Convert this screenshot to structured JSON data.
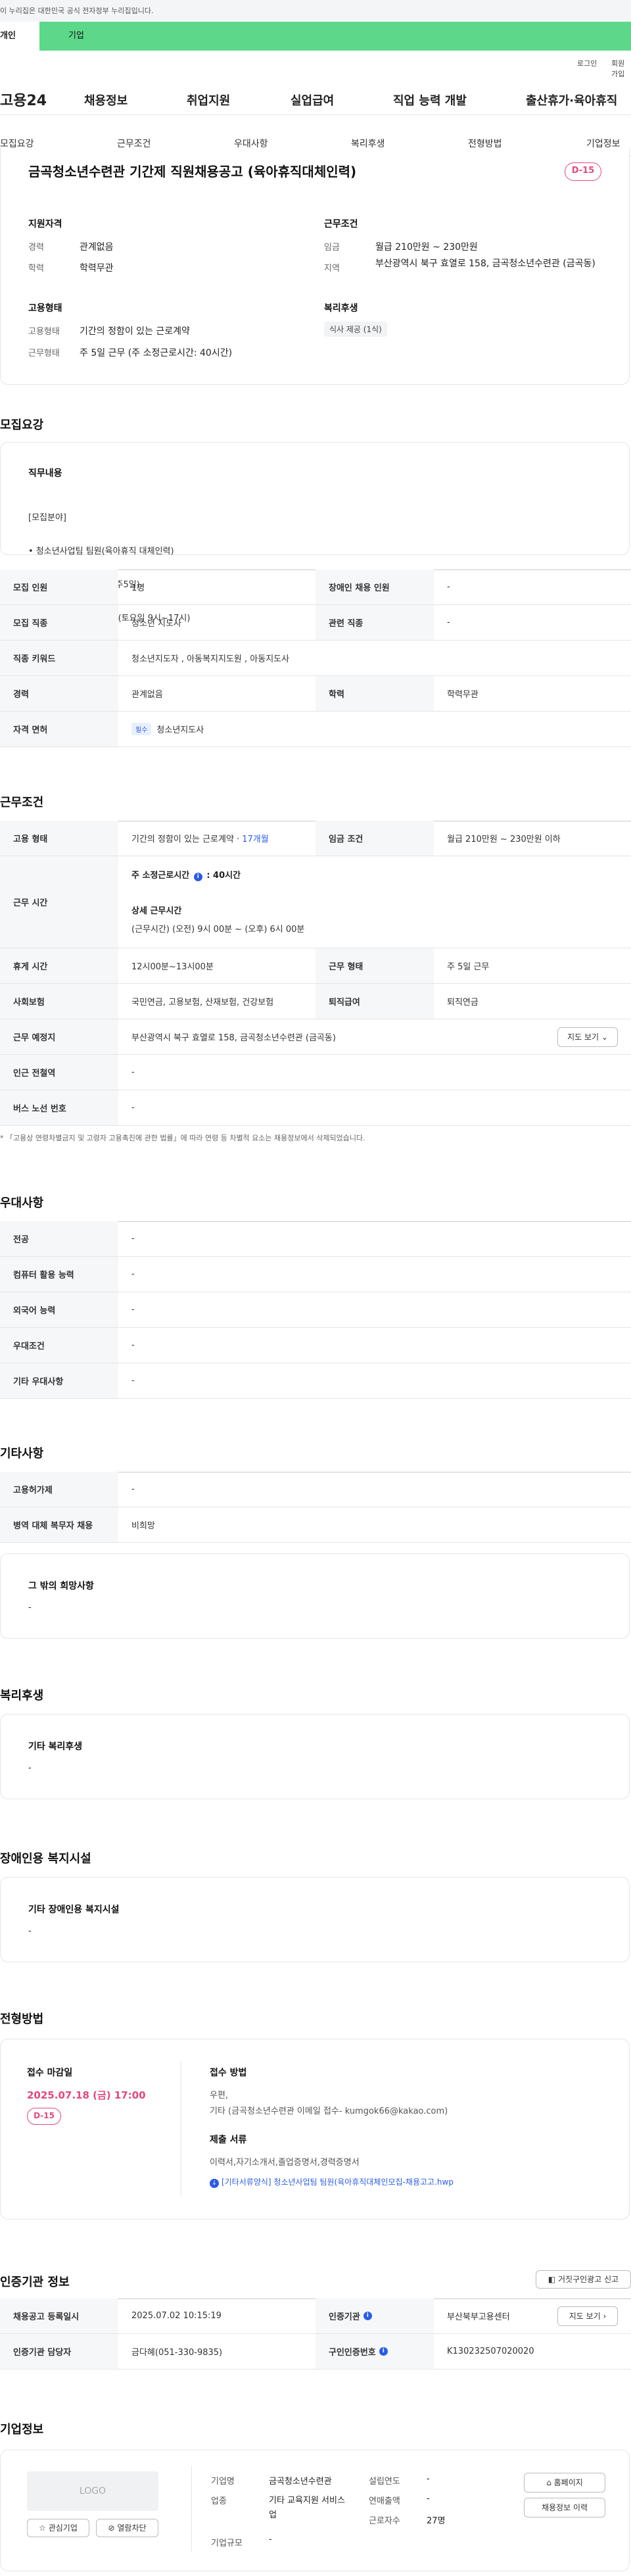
{
  "gov_banner": "이 누리집은 대한민국 공식 전자정부 누리집입니다.",
  "tabs": {
    "individual": "개인",
    "enterprise": "기업"
  },
  "util": {
    "login": "로그인",
    "join": "회원가입"
  },
  "gnb": {
    "logo": "고용24",
    "menus": [
      "채용정보",
      "취업지원",
      "실업급여",
      "직업 능력 개발",
      "출산휴가·육아휴직"
    ]
  },
  "anchors": [
    "모집요강",
    "근무조건",
    "우대사항",
    "복리후생",
    "전형방법",
    "기업정보"
  ],
  "summary": {
    "title": "금곡청소년수련관 기간제 직원채용공고 (육아휴직대체인력)",
    "dday": "D-15",
    "qual_title": "지원자격",
    "career_l": "경력",
    "career_v": "관계없음",
    "edu_l": "학력",
    "edu_v": "학력무관",
    "cond_title": "근무조건",
    "wage_l": "임금",
    "wage_v": "월급 210만원 ~ 230만원",
    "region_l": "지역",
    "region_v": "부산광역시 북구 효열로 158, 금곡청소년수련관 (금곡동)",
    "emp_title": "고용형태",
    "emptype_l": "고용형태",
    "emptype_v": "기간의 정함이 있는 근로계약",
    "worktype_l": "근무형태",
    "worktype_v": "주 5일 근무 (주 소정근로시간: 40시간)",
    "welfare_title": "복리후생",
    "welfare_tag": "식사 제공 (1식)"
  },
  "recruit": {
    "section": "모집요강",
    "duty_title": "직무내용",
    "duty_lines": [
      "[모집분야]",
      "• 청소년사업팀 팀원(육아휴직 대체인력)",
      "  근무요일 : 화~토요일(주5일)",
      "  근무시간 : 9시 ~ 18시(토요일 9시~17시)"
    ],
    "rows": [
      {
        "l1": "모집 인원",
        "v1": "1명",
        "l2": "장애인 채용 인원",
        "v2": "-"
      },
      {
        "l1": "모집 직종",
        "v1": "청소년 지도사",
        "l2": "관련 직종",
        "v2": "-"
      },
      {
        "l1": "직종 키워드",
        "v1": "청소년지도자 , 아동복지지도원 , 아동지도사"
      },
      {
        "l1": "경력",
        "v1": "관계없음",
        "l2": "학력",
        "v2": "학력무관"
      },
      {
        "l1": "자격 면허",
        "tag": "필수",
        "v1": "청소년지도사"
      }
    ]
  },
  "work": {
    "section": "근무조건",
    "emp_l": "고용 형태",
    "emp_v": "기간의 정함이 있는 근로계약 · ",
    "emp_months": "17개월",
    "wage_l": "임금 조건",
    "wage_v": "월급 210만원 ~ 230만원 이하",
    "time_l": "근무 시간",
    "time_head": "주 소정근로시간",
    "time_val": ": 40시간",
    "time_detail_t": "상세 근무시간",
    "time_detail_v": "(근무시간) (오전) 9시 00분 ~ (오후) 6시 00분",
    "rest_l": "휴게 시간",
    "rest_v": "12시00분~13시00분",
    "form_l": "근무 형태",
    "form_v": "주 5일 근무",
    "ins_l": "사회보험",
    "ins_v": "국민연금, 고용보험, 산재보험, 건강보험",
    "ret_l": "퇴직급여",
    "ret_v": "퇴직연금",
    "place_l": "근무 예정지",
    "place_v": "부산광역시 북구 효열로 158, 금곡청소년수련관 (금곡동)",
    "map_btn": "지도 보기",
    "subway_l": "인근 전철역",
    "subway_v": "-",
    "bus_l": "버스 노선 번호",
    "bus_v": "-",
    "note": "* 「고용상 연령차별금지 및 고령자 고용촉진에 관한 법률」에 따라 연령 등 차별적 요소는 채용정보에서 삭제되었습니다."
  },
  "pref": {
    "section": "우대사항",
    "rows": [
      [
        "전공",
        "-"
      ],
      [
        "컴퓨터 활용 능력",
        "-"
      ],
      [
        "외국어 능력",
        "-"
      ],
      [
        "우대조건",
        "-"
      ],
      [
        "기타 우대사항",
        "-"
      ]
    ]
  },
  "etc": {
    "section": "기타사항",
    "rows": [
      [
        "고용허가제",
        "-"
      ],
      [
        "병역 대체 복무자 채용",
        "비희망"
      ]
    ],
    "other_title": "그 밖의 희망사항",
    "other_v": "-"
  },
  "welfare": {
    "section": "복리후생",
    "title": "기타 복리후생",
    "v": "-"
  },
  "disability": {
    "section": "장애인용 복지시설",
    "title": "기타 장애인용 복지시설",
    "v": "-"
  },
  "selection": {
    "section": "전형방법",
    "deadline_t": "접수 마감일",
    "deadline_v": "2025.07.18 (금) 17:00",
    "dday": "D-15",
    "method_t": "접수 방법",
    "method_v1": "우편,",
    "method_v2": "기타 (금곡청소년수련관 이메일 접수- kumgok66@kakao.com)",
    "docs_t": "제출 서류",
    "docs_v": "이력서,자기소개서,졸업증명서,경력증명서",
    "file": "[기타서류양식] 청소년사업팀 팀원(육아휴직대체인모집-채용고고.hwp"
  },
  "agency": {
    "section": "인증기관 정보",
    "report_btn": "거짓구인광고 신고",
    "reg_l": "채용공고 등록일시",
    "reg_v": "2025.07.02 10:15:19",
    "org_l": "인증기관",
    "org_v": "부산북부고용센터",
    "detail_btn": "지도 보기",
    "mgr_l": "인증기관 담당자",
    "mgr_v": "금다혜(051-330-9835)",
    "num_l": "구인인증번호",
    "num_v": "K130232507020020"
  },
  "company": {
    "section": "기업정보",
    "logo": "LOGO",
    "fav_btn": "관심기업",
    "block_btn": "열람차단",
    "name_l": "기업명",
    "name_v": "금곡청소년수련관",
    "ind_l": "업종",
    "ind_v": "기타 교육지원 서비스업",
    "size_l": "기업규모",
    "size_v": "-",
    "est_l": "설립연도",
    "est_v": "-",
    "sales_l": "연매출액",
    "sales_v": "-",
    "emp_l": "근로자수",
    "emp_v": "27명",
    "home_btn": "홈페이지",
    "hist_btn": "채용정보 이력"
  },
  "colors": {
    "brand_green": "#5dd88a",
    "dday": "#e4487a",
    "link_blue": "#2b5ce6"
  }
}
